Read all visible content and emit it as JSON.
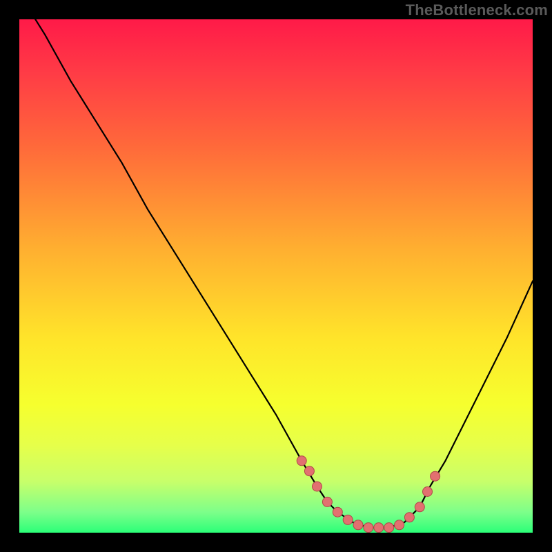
{
  "watermark": "TheBottleneck.com",
  "colors": {
    "frame": "#000000",
    "curve": "#000000",
    "marker_fill": "#e27070",
    "marker_stroke": "#b04848"
  },
  "chart_data": {
    "type": "line",
    "title": "",
    "xlabel": "",
    "ylabel": "",
    "xlim": [
      0,
      100
    ],
    "ylim": [
      0,
      100
    ],
    "series": [
      {
        "name": "bottleneck-curve",
        "x": [
          0,
          5,
          10,
          15,
          20,
          25,
          30,
          35,
          40,
          45,
          50,
          55,
          58,
          60,
          62,
          65,
          68,
          70,
          72,
          75,
          78,
          80,
          83,
          86,
          90,
          95,
          100
        ],
        "y": [
          105,
          97,
          88,
          80,
          72,
          63,
          55,
          47,
          39,
          31,
          23,
          14,
          9,
          6,
          4,
          2,
          1,
          1,
          1,
          2,
          5,
          9,
          14,
          20,
          28,
          38,
          49
        ]
      }
    ],
    "markers": {
      "name": "highlight-dots",
      "x": [
        55,
        56.5,
        58,
        60,
        62,
        64,
        66,
        68,
        70,
        72,
        74,
        76,
        78,
        79.5,
        81
      ],
      "y": [
        14,
        12,
        9,
        6,
        4,
        2.5,
        1.5,
        1,
        1,
        1,
        1.5,
        3,
        5,
        8,
        11
      ]
    }
  }
}
